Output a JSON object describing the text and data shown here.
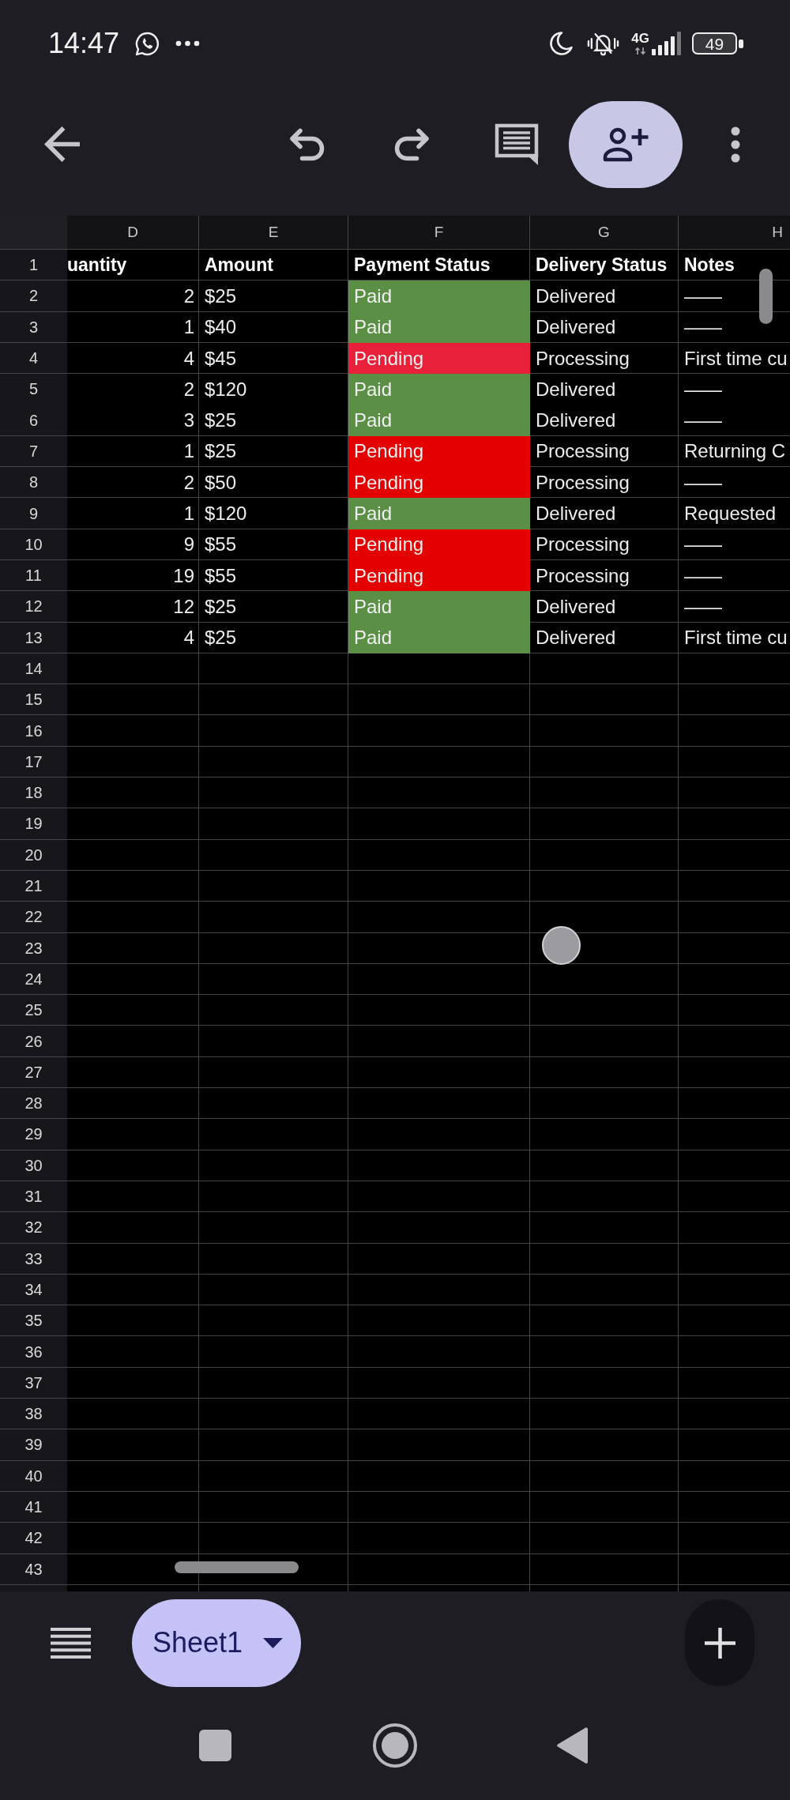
{
  "status_bar": {
    "time": "14:47",
    "network": "4G",
    "battery": "49"
  },
  "sheet": {
    "column_letters": [
      "D",
      "E",
      "F",
      "G",
      "H"
    ],
    "header_row": {
      "number": "1",
      "cells": [
        "uantity",
        "Amount",
        "Payment Status",
        "Delivery Status",
        "Notes"
      ]
    },
    "rows": [
      {
        "number": "2",
        "quantity": "2",
        "amount": "$25",
        "payment": {
          "label": "Paid",
          "color": "#5a8f45"
        },
        "delivery": "Delivered",
        "notes": "——"
      },
      {
        "number": "3",
        "quantity": "1",
        "amount": "$40",
        "payment": {
          "label": "Paid",
          "color": "#5a8f45"
        },
        "delivery": "Delivered",
        "notes": "——"
      },
      {
        "number": "4",
        "quantity": "4",
        "amount": "$45",
        "payment": {
          "label": "Pending",
          "color": "#e8203a"
        },
        "delivery": "Processing",
        "notes": "First time cu"
      },
      {
        "number": "5",
        "quantity": "2",
        "amount": "$120",
        "payment": {
          "label": "Paid",
          "color": "#5a8f45"
        },
        "delivery": "Delivered",
        "notes": "——"
      },
      {
        "number": "6",
        "quantity": "3",
        "amount": "$25",
        "payment": {
          "label": "Paid",
          "color": "#5a8f45"
        },
        "delivery": "Delivered",
        "notes": "——"
      },
      {
        "number": "7",
        "quantity": "1",
        "amount": "$25",
        "payment": {
          "label": "Pending",
          "color": "#e40000"
        },
        "delivery": "Processing",
        "notes": "Returning C"
      },
      {
        "number": "8",
        "quantity": "2",
        "amount": "$50",
        "payment": {
          "label": "Pending",
          "color": "#e40000"
        },
        "delivery": "Processing",
        "notes": "——"
      },
      {
        "number": "9",
        "quantity": "1",
        "amount": "$120",
        "payment": {
          "label": "Paid",
          "color": "#5a8f45"
        },
        "delivery": "Delivered",
        "notes": "Requested"
      },
      {
        "number": "10",
        "quantity": "9",
        "amount": "$55",
        "payment": {
          "label": "Pending",
          "color": "#e40000"
        },
        "delivery": "Processing",
        "notes": "——"
      },
      {
        "number": "11",
        "quantity": "19",
        "amount": "$55",
        "payment": {
          "label": "Pending",
          "color": "#e40000"
        },
        "delivery": "Processing",
        "notes": "——"
      },
      {
        "number": "12",
        "quantity": "12",
        "amount": "$25",
        "payment": {
          "label": "Paid",
          "color": "#5a8f45"
        },
        "delivery": "Delivered",
        "notes": "——"
      },
      {
        "number": "13",
        "quantity": "4",
        "amount": "$25",
        "payment": {
          "label": "Paid",
          "color": "#5a8f45"
        },
        "delivery": "Delivered",
        "notes": "First time cu"
      }
    ],
    "empty_rows": [
      "14",
      "15",
      "16",
      "17",
      "18",
      "19",
      "20",
      "21",
      "22",
      "23",
      "24",
      "25",
      "26",
      "27",
      "28",
      "29",
      "30",
      "31",
      "32",
      "33",
      "34",
      "35",
      "36",
      "37",
      "38",
      "39",
      "40",
      "41",
      "42",
      "43"
    ]
  },
  "sheet_tabs": [
    {
      "label": "Sheet1",
      "selected": true
    }
  ]
}
